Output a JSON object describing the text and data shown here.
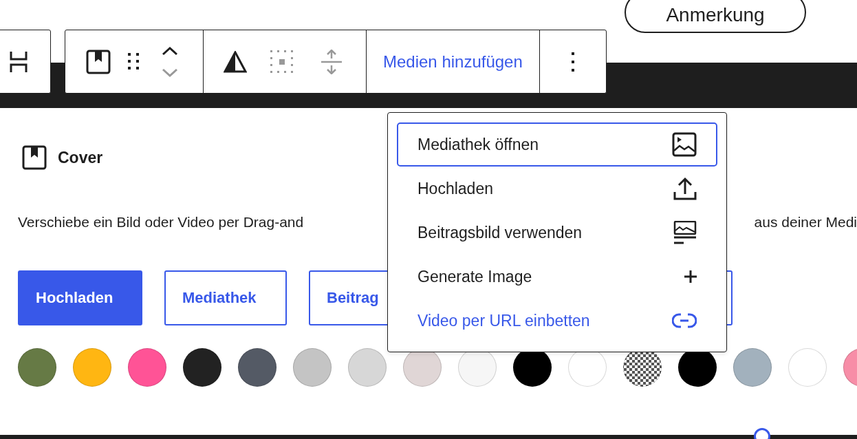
{
  "top_button": {
    "label": "Anmerkung"
  },
  "toolbar": {
    "media_button": {
      "label": "Medien hinzufügen"
    }
  },
  "block": {
    "title": "Cover",
    "description_left": "Verschiebe ein Bild oder Video per Drag-and",
    "description_right": "aus deiner Medi"
  },
  "buttons": [
    {
      "label": "Hochladen",
      "kind": "primary"
    },
    {
      "label": "Mediathek",
      "kind": "secondary"
    },
    {
      "label": "Beitrag",
      "kind": "secondary"
    }
  ],
  "swatches": [
    {
      "kind": "solid",
      "color": "#667a45"
    },
    {
      "kind": "solid",
      "color": "#ffb612"
    },
    {
      "kind": "solid",
      "color": "#ff5396"
    },
    {
      "kind": "solid",
      "color": "#222222"
    },
    {
      "kind": "solid",
      "color": "#545a65"
    },
    {
      "kind": "solid",
      "color": "#c4c4c4"
    },
    {
      "kind": "solid",
      "color": "#d7d7d7"
    },
    {
      "kind": "solid",
      "color": "#e0d6d6"
    },
    {
      "kind": "solid",
      "color": "#f6f6f6"
    },
    {
      "kind": "solid",
      "color": "#000000"
    },
    {
      "kind": "solid",
      "color": "#ffffff"
    },
    {
      "kind": "transparent",
      "color": "#ffffff"
    },
    {
      "kind": "solid",
      "color": "#000000"
    },
    {
      "kind": "solid",
      "color": "#a2b1bd"
    },
    {
      "kind": "solid",
      "color": "#ffffff"
    },
    {
      "kind": "solid",
      "color": "#f78da7"
    }
  ],
  "menu": {
    "items": [
      {
        "label": "Mediathek öffnen",
        "kind": "normal",
        "selected": true
      },
      {
        "label": "Hochladen",
        "kind": "normal",
        "selected": false
      },
      {
        "label": "Beitragsbild verwenden",
        "kind": "normal",
        "selected": false
      },
      {
        "label": "Generate Image",
        "kind": "normal",
        "selected": false
      },
      {
        "label": "Video per URL einbetten",
        "kind": "link",
        "selected": false
      }
    ]
  }
}
